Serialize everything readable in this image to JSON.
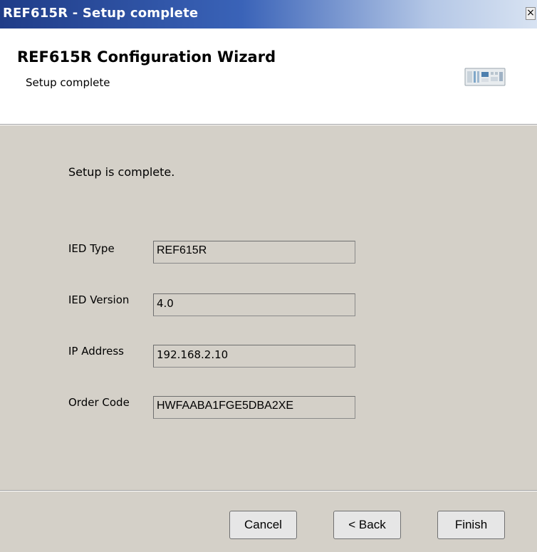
{
  "window": {
    "title": "REF615R - Setup complete",
    "close_label": "×"
  },
  "header": {
    "title": "REF615R Configuration Wizard",
    "subtitle": "Setup complete",
    "image_icon": "relay-device-icon"
  },
  "main": {
    "message": "Setup is complete.",
    "fields": [
      {
        "label": "IED Type",
        "value": "REF615R"
      },
      {
        "label": "IED Version",
        "value": "4.0"
      },
      {
        "label": "IP Address",
        "value": "192.168.2.10"
      },
      {
        "label": "Order Code",
        "value": "HWFAABA1FGE5DBA2XE"
      }
    ]
  },
  "buttons": {
    "cancel": "Cancel",
    "back": "< Back",
    "finish": "Finish"
  },
  "colors": {
    "title_bar_start": "#1f3c88",
    "title_bar_end": "#d8e3f2",
    "dialog_background": "#d4d0c8",
    "header_background": "#ffffff"
  }
}
